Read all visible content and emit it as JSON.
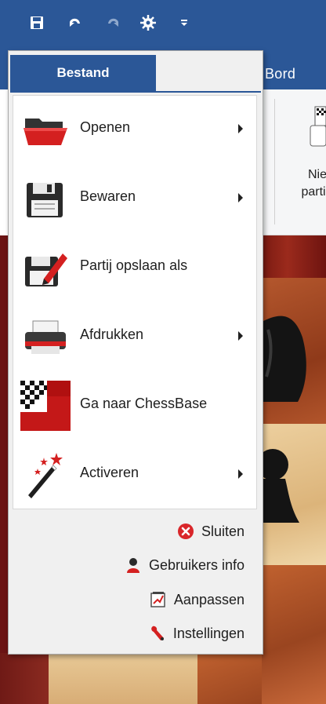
{
  "quick_access_toolbar": {
    "icons": [
      "save-icon",
      "undo-icon",
      "redo-icon",
      "engine-icon",
      "customize-qat-icon"
    ]
  },
  "ribbon": {
    "tabs": {
      "file_label": "Bestand",
      "board_label": "Bord"
    },
    "new_game_label_line1": "Nie",
    "new_game_label_line2": "parti"
  },
  "file_menu": {
    "items": [
      {
        "label": "Openen",
        "icon": "folder-open-icon",
        "has_submenu": true
      },
      {
        "label": "Bewaren",
        "icon": "floppy-disk-icon",
        "has_submenu": true
      },
      {
        "label": "Partij opslaan als",
        "icon": "save-as-icon",
        "has_submenu": false
      },
      {
        "label": "Afdrukken",
        "icon": "printer-icon",
        "has_submenu": true
      },
      {
        "label": "Ga naar ChessBase",
        "icon": "chessbase-icon",
        "has_submenu": false
      },
      {
        "label": "Activeren",
        "icon": "magic-wand-icon",
        "has_submenu": true
      }
    ],
    "footer": [
      {
        "label": "Sluiten",
        "icon": "close-icon"
      },
      {
        "label": "Gebruikers info",
        "icon": "user-icon"
      },
      {
        "label": "Aanpassen",
        "icon": "customize-icon"
      },
      {
        "label": "Instellingen",
        "icon": "settings-wrench-icon"
      }
    ]
  },
  "colors": {
    "ribbon_blue": "#2b5797",
    "menu_bg": "#f0f0f0",
    "close_red": "#d9262a"
  }
}
